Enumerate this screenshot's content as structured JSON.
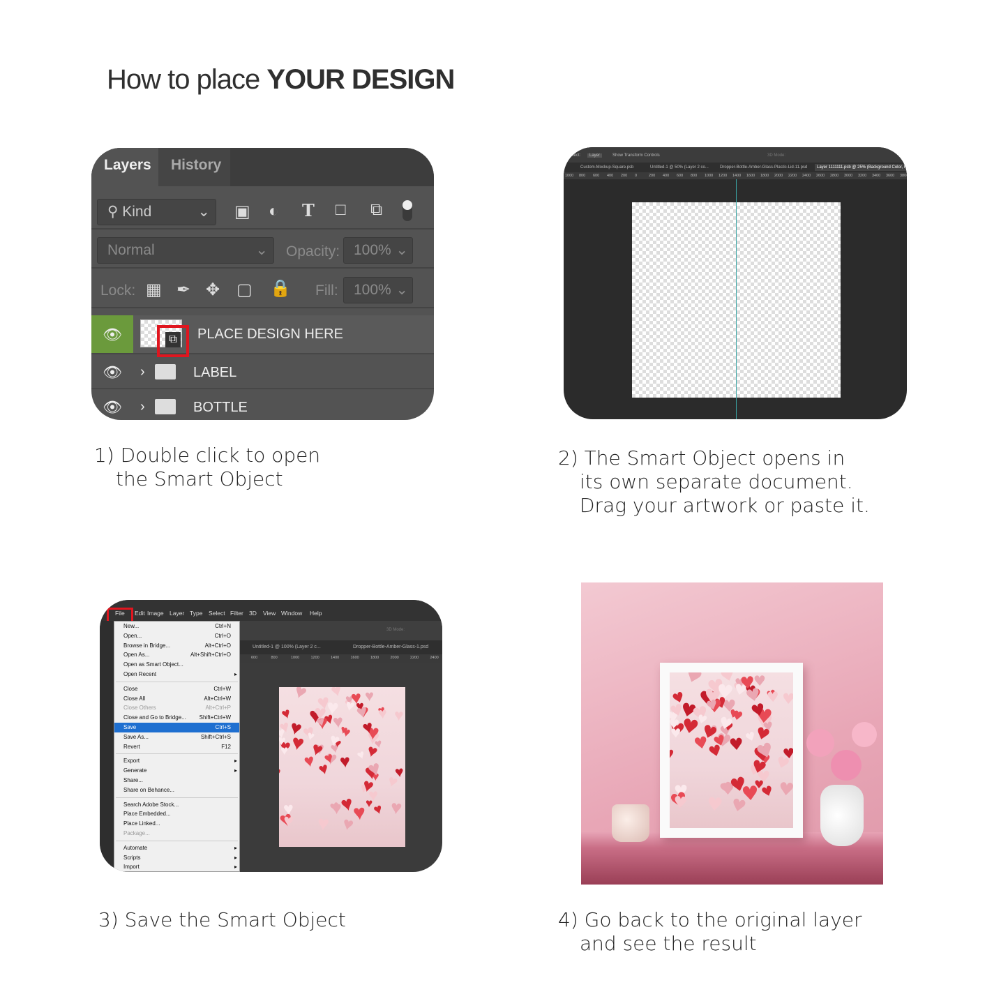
{
  "title": {
    "prefix": "How to place ",
    "emph": "YOUR DESIGN"
  },
  "step1": {
    "caption": [
      "1) Double click to open",
      "the Smart Object"
    ],
    "tabs": [
      "Layers",
      "History"
    ],
    "filter": "Kind",
    "blend_mode": "Normal",
    "opacity_label": "Opacity:",
    "opacity": "100%",
    "lock_label": "Lock:",
    "fill_label": "Fill:",
    "fill": "100%",
    "layers": [
      {
        "name": "PLACE DESIGN HERE",
        "type": "smart-object",
        "selected": true
      },
      {
        "name": "LABEL",
        "type": "group"
      },
      {
        "name": "BOTTLE",
        "type": "group"
      }
    ],
    "highlight_color": "#e0161f",
    "selected_color": "#6b9a3c"
  },
  "step2": {
    "caption": [
      "2) The Smart Object opens in",
      "its own separate document.",
      "Drag your artwork or paste it."
    ],
    "options": {
      "select": "Select:",
      "layer": "Layer",
      "transform": "Show Transform Controls",
      "mode": "3D Mode:"
    },
    "doc_tabs": [
      "Custom-Mockup-Square.psb",
      "Untitled-1 @ 50% (Layer 2 co...",
      "Dropper-Bottle-Amber-Glass-Plastic-Lid-11.psd",
      "Layer 1111111.psb @ 25% (Background Color, RG"
    ],
    "ruler": [
      "1000",
      "800",
      "600",
      "400",
      "200",
      "0",
      "200",
      "400",
      "600",
      "800",
      "1000",
      "1200",
      "1400",
      "1600",
      "1800",
      "2000",
      "2200",
      "2400",
      "2600",
      "2800",
      "3000",
      "3200",
      "3400",
      "3600",
      "3800"
    ]
  },
  "step3": {
    "caption": [
      "3) Save the Smart Object"
    ],
    "menubar": [
      "File",
      "Edit",
      "Image",
      "Layer",
      "Type",
      "Select",
      "Filter",
      "3D",
      "View",
      "Window",
      "Help"
    ],
    "menu": [
      [
        {
          "l": "New...",
          "s": "Ctrl+N"
        },
        {
          "l": "Open...",
          "s": "Ctrl+O"
        },
        {
          "l": "Browse in Bridge...",
          "s": "Alt+Ctrl+O"
        },
        {
          "l": "Open As...",
          "s": "Alt+Shift+Ctrl+O"
        },
        {
          "l": "Open as Smart Object...",
          "s": ""
        },
        {
          "l": "Open Recent",
          "s": "",
          "sub": true
        }
      ],
      [
        {
          "l": "Close",
          "s": "Ctrl+W"
        },
        {
          "l": "Close All",
          "s": "Alt+Ctrl+W"
        },
        {
          "l": "Close Others",
          "s": "Alt+Ctrl+P",
          "dis": true
        },
        {
          "l": "Close and Go to Bridge...",
          "s": "Shift+Ctrl+W"
        },
        {
          "l": "Save",
          "s": "Ctrl+S",
          "sel": true
        },
        {
          "l": "Save As...",
          "s": "Shift+Ctrl+S"
        },
        {
          "l": "Revert",
          "s": "F12"
        }
      ],
      [
        {
          "l": "Export",
          "s": "",
          "sub": true
        },
        {
          "l": "Generate",
          "s": "",
          "sub": true
        },
        {
          "l": "Share...",
          "s": ""
        },
        {
          "l": "Share on Behance...",
          "s": ""
        }
      ],
      [
        {
          "l": "Search Adobe Stock...",
          "s": ""
        },
        {
          "l": "Place Embedded...",
          "s": ""
        },
        {
          "l": "Place Linked...",
          "s": ""
        },
        {
          "l": "Package...",
          "s": "",
          "dis": true
        }
      ],
      [
        {
          "l": "Automate",
          "s": "",
          "sub": true
        },
        {
          "l": "Scripts",
          "s": "",
          "sub": true
        },
        {
          "l": "Import",
          "s": "",
          "sub": true
        }
      ]
    ],
    "doc_tabs": [
      "Untitled-1 @ 100% (Layer 2 c...",
      "Dropper-Bottle-Amber-Glass-1.psd"
    ],
    "ruler": [
      "600",
      "800",
      "1000",
      "1200",
      "1400",
      "1600",
      "1800",
      "2000",
      "2200",
      "2400"
    ],
    "mode": "3D Mode:"
  },
  "step4": {
    "caption": [
      "4) Go back to the original layer",
      "and see the result"
    ]
  }
}
